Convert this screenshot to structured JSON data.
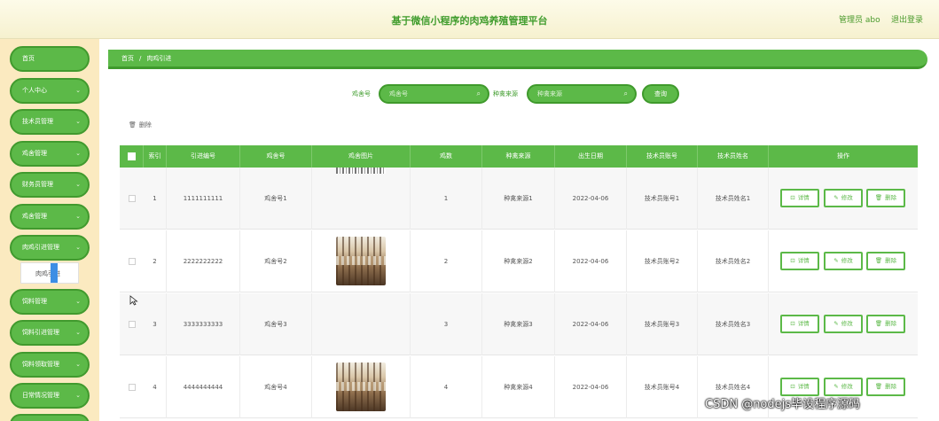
{
  "header": {
    "title": "基于微信小程序的肉鸡养殖管理平台",
    "user": "管理员 abo",
    "logout": "退出登录"
  },
  "sidebar": {
    "items": [
      {
        "label": "首页",
        "has_arrow": false
      },
      {
        "label": "个人中心",
        "has_arrow": true
      },
      {
        "label": "技术员管理",
        "has_arrow": true
      },
      {
        "label": "鸡舍管理",
        "has_arrow": true
      },
      {
        "label": "财务员管理",
        "has_arrow": true
      },
      {
        "label": "鸡舍管理",
        "has_arrow": true
      },
      {
        "label": "肉鸡引进管理",
        "has_arrow": true
      },
      {
        "label": "饲料管理",
        "has_arrow": true
      },
      {
        "label": "饲料引进管理",
        "has_arrow": true
      },
      {
        "label": "饲料领取管理",
        "has_arrow": true
      },
      {
        "label": "日常情况管理",
        "has_arrow": true
      }
    ],
    "submenu_item": "肉鸡引进"
  },
  "breadcrumb": {
    "home": "首页",
    "separator": "/",
    "current": "肉鸡引进"
  },
  "search": {
    "field1_label": "鸡舍号",
    "field1_placeholder": "鸡舍号",
    "field2_label": "种禽来源",
    "field2_placeholder": "种禽来源",
    "query_button": "查询"
  },
  "toolbar": {
    "delete_label": "删除",
    "delete_icon": "trash-icon"
  },
  "table": {
    "headers": [
      "索引",
      "引进编号",
      "鸡舍号",
      "鸡舍图片",
      "鸡数",
      "种禽来源",
      "出生日期",
      "技术员账号",
      "技术员姓名",
      "操作"
    ],
    "rows": [
      {
        "index": "1",
        "code": "1111111111",
        "coop": "鸡舍号1",
        "count": "1",
        "source": "种禽来源1",
        "birth": "2022-04-06",
        "tech_account": "技术员账号1",
        "tech_name": "技术员姓名1",
        "image": "cropped"
      },
      {
        "index": "2",
        "code": "2222222222",
        "coop": "鸡舍号2",
        "count": "2",
        "source": "种禽来源2",
        "birth": "2022-04-06",
        "tech_account": "技术员账号2",
        "tech_name": "技术员姓名2",
        "image": "photo"
      },
      {
        "index": "3",
        "code": "3333333333",
        "coop": "鸡舍号3",
        "count": "3",
        "source": "种禽来源3",
        "birth": "2022-04-06",
        "tech_account": "技术员账号3",
        "tech_name": "技术员姓名3",
        "image": "none"
      },
      {
        "index": "4",
        "code": "4444444444",
        "coop": "鸡舍号4",
        "count": "4",
        "source": "种禽来源4",
        "birth": "2022-04-06",
        "tech_account": "技术员账号4",
        "tech_name": "技术员姓名4",
        "image": "photo"
      }
    ],
    "actions": {
      "detail": "详情",
      "edit": "修改",
      "delete": "删除"
    }
  },
  "watermark": "CSDN @nodejs毕设程序源码",
  "colors": {
    "accent": "#5cb948",
    "accent_dark": "#3f9a2c",
    "sidebar_bg": "#fbeac0",
    "header_bg": "#f6f1cf"
  }
}
